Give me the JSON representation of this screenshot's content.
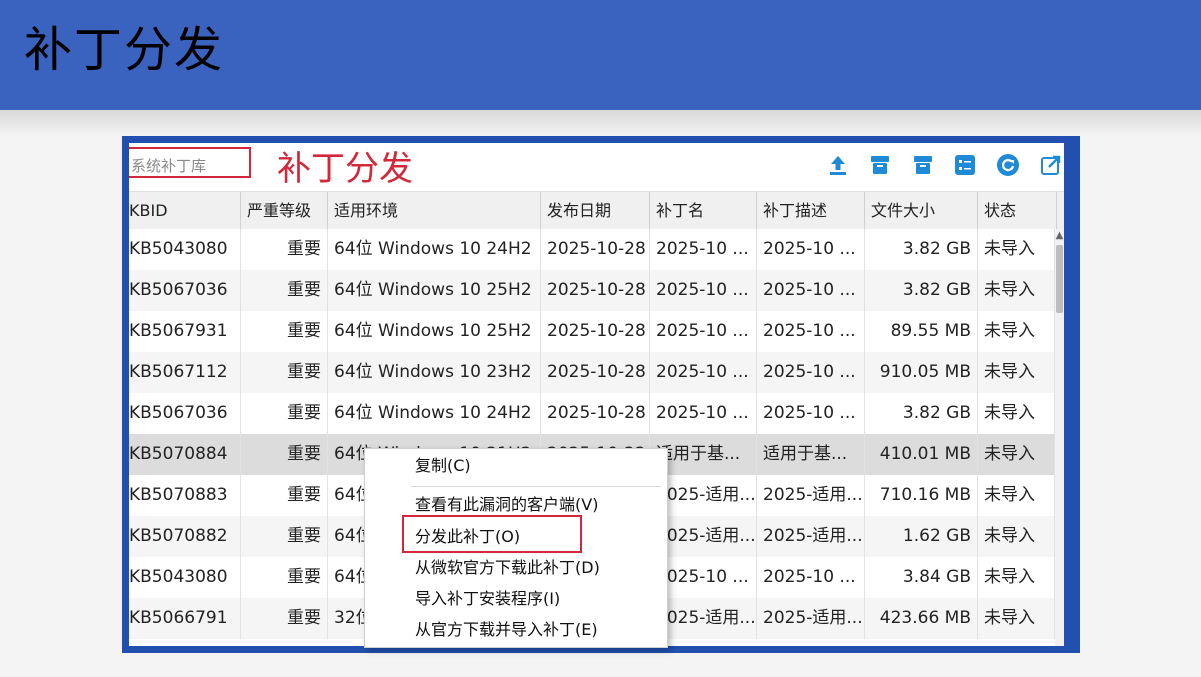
{
  "slide": {
    "title": "补丁分发"
  },
  "toolbar": {
    "search_placeholder": "系统补丁库",
    "annotation": "补丁分发",
    "icons": [
      "upload-icon",
      "box-icon",
      "box-alt-icon",
      "checklist-icon",
      "refresh-icon",
      "export-icon"
    ]
  },
  "colors": {
    "header": "#3a63c0",
    "frame": "#2150b0",
    "annotation": "#d3283a",
    "icon": "#1e8ad8"
  },
  "columns": [
    "KBID",
    "严重等级",
    "适用环境",
    "发布日期",
    "补丁名",
    "补丁描述",
    "文件大小",
    "状态"
  ],
  "rows": [
    {
      "kbid": "KB5043080",
      "severity": "重要",
      "env": "64位 Windows 10 24H2",
      "date": "2025-10-28",
      "name": "2025-10 ...",
      "desc": "2025-10 ...",
      "size": "3.82 GB",
      "status": "未导入"
    },
    {
      "kbid": "KB5067036",
      "severity": "重要",
      "env": "64位 Windows 10 25H2",
      "date": "2025-10-28",
      "name": "2025-10 ...",
      "desc": "2025-10 ...",
      "size": "3.82 GB",
      "status": "未导入"
    },
    {
      "kbid": "KB5067931",
      "severity": "重要",
      "env": "64位 Windows 10 25H2",
      "date": "2025-10-28",
      "name": "2025-10 ...",
      "desc": "2025-10 ...",
      "size": "89.55 MB",
      "status": "未导入"
    },
    {
      "kbid": "KB5067112",
      "severity": "重要",
      "env": "64位 Windows 10 23H2",
      "date": "2025-10-28",
      "name": "2025-10 ...",
      "desc": "2025-10 ...",
      "size": "910.05 MB",
      "status": "未导入"
    },
    {
      "kbid": "KB5067036",
      "severity": "重要",
      "env": "64位 Windows 10 24H2",
      "date": "2025-10-28",
      "name": "2025-10 ...",
      "desc": "2025-10 ...",
      "size": "3.82 GB",
      "status": "未导入"
    },
    {
      "kbid": "KB5070884",
      "severity": "重要",
      "env": "64位 Windows 10 21H2",
      "date": "2025-10-22",
      "name": "适用于基...",
      "desc": "适用于基...",
      "size": "410.01 MB",
      "status": "未导入"
    },
    {
      "kbid": "KB5070883",
      "severity": "重要",
      "env": "64位",
      "date": "",
      "name": "2025-适用...",
      "desc": "2025-适用...",
      "size": "710.16 MB",
      "status": "未导入"
    },
    {
      "kbid": "KB5070882",
      "severity": "重要",
      "env": "64位",
      "date": "",
      "name": "2025-适用...",
      "desc": "2025-适用...",
      "size": "1.62 GB",
      "status": "未导入"
    },
    {
      "kbid": "KB5043080",
      "severity": "重要",
      "env": "64位",
      "date": "",
      "name": "2025-10 ...",
      "desc": "2025-10 ...",
      "size": "3.84 GB",
      "status": "未导入"
    },
    {
      "kbid": "KB5066791",
      "severity": "重要",
      "env": "32位",
      "date": "",
      "name": "2025-适用...",
      "desc": "2025-适用...",
      "size": "423.66 MB",
      "status": "未导入"
    }
  ],
  "context_menu": {
    "items": [
      "复制(C)",
      "查看有此漏洞的客户端(V)",
      "分发此补丁(O)",
      "从微软官方下载此补丁(D)",
      "导入补丁安装程序(I)",
      "从官方下载并导入补丁(E)"
    ]
  }
}
